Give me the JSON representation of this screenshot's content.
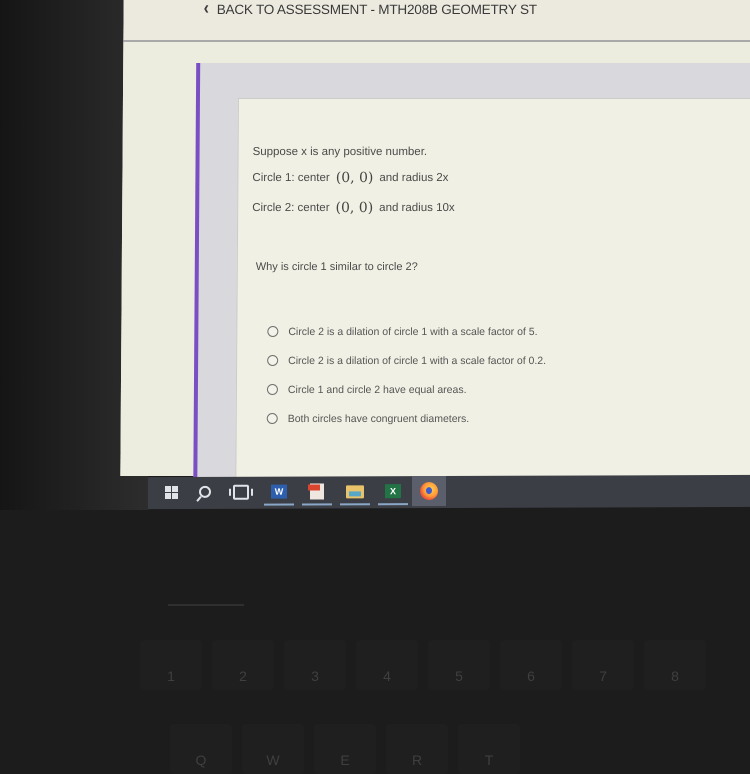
{
  "header": {
    "back_icon": "chevron-left-icon",
    "back_label": "BACK TO ASSESSMENT - MTH208B GEOMETRY ST"
  },
  "colors": {
    "accent_border": "#7b4fc4",
    "taskbar": "#3c3e45",
    "card_background": "#f1f0e4"
  },
  "problem": {
    "intro": "Suppose x is any positive number.",
    "circle1": {
      "label": "Circle 1: center",
      "center": "(0, 0)",
      "radius_text": "and radius 2x"
    },
    "circle2": {
      "label": "Circle 2: center",
      "center": "(0, 0)",
      "radius_text": "and radius 10x"
    },
    "question": "Why is circle 1 similar to circle 2?",
    "choices": [
      {
        "label": "Circle 2 is a dilation of circle 1 with a scale factor of 5.",
        "selected": false
      },
      {
        "label": "Circle 2 is a dilation of circle 1 with a scale factor of 0.2.",
        "selected": false
      },
      {
        "label": "Circle 1 and circle 2 have equal areas.",
        "selected": false
      },
      {
        "label": "Both circles have congruent diameters.",
        "selected": false
      }
    ]
  },
  "taskbar": {
    "items": [
      {
        "name": "start",
        "icon": "windows-logo-icon"
      },
      {
        "name": "search",
        "icon": "search-icon"
      },
      {
        "name": "task-view",
        "icon": "task-view-icon"
      },
      {
        "name": "word",
        "icon": "word-icon",
        "glyph": "W",
        "open": true
      },
      {
        "name": "pdf",
        "icon": "pdf-icon",
        "open": true
      },
      {
        "name": "file-explorer",
        "icon": "folder-icon",
        "open": true
      },
      {
        "name": "excel",
        "icon": "excel-icon",
        "glyph": "X",
        "open": true
      },
      {
        "name": "firefox",
        "icon": "firefox-icon",
        "active": true
      }
    ]
  },
  "keyboard": {
    "number_row": [
      "1",
      "2",
      "3",
      "4",
      "5",
      "6",
      "7",
      "8"
    ],
    "letter_row": [
      "Q",
      "W",
      "E",
      "R",
      "T"
    ]
  }
}
